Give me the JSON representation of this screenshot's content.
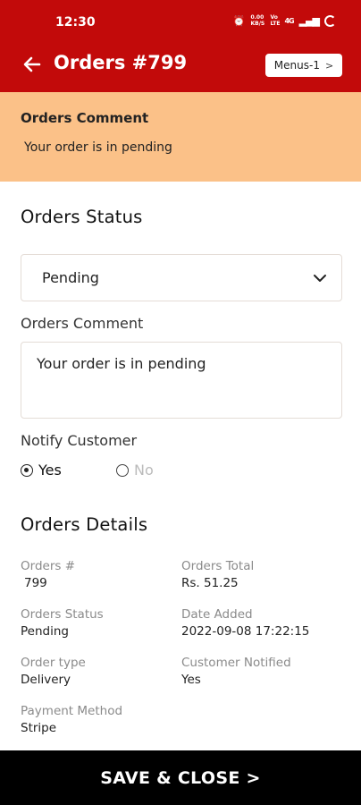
{
  "status_bar": {
    "time": "12:30",
    "data_speed": "0.00 KB/S",
    "network": "Vo LTE",
    "signal": "4G"
  },
  "header": {
    "title": "Orders #799",
    "menus_label": "Menus-1",
    "menus_chevron": ">",
    "background": "#c20a0a"
  },
  "comment_banner": {
    "heading": "Orders Comment",
    "text": "Your order is in pending",
    "background": "#fbc188"
  },
  "status_section": {
    "title": "Orders Status",
    "selected_status": "Pending",
    "comment_label": "Orders Comment",
    "comment_value": "Your order is in pending",
    "notify_label": "Notify Customer",
    "notify_options": [
      {
        "label": "Yes",
        "selected": true
      },
      {
        "label": "No",
        "selected": false
      }
    ]
  },
  "details": {
    "title": "Orders Details",
    "fields": [
      {
        "label": "Orders #",
        "value": "799"
      },
      {
        "label": "Orders Total",
        "value": "Rs.  51.25"
      },
      {
        "label": "Orders Status",
        "value": "Pending"
      },
      {
        "label": "Date Added",
        "value": "2022-09-08  17:22:15"
      },
      {
        "label": "Order type",
        "value": "Delivery"
      },
      {
        "label": "Customer Notified",
        "value": "Yes"
      },
      {
        "label": "Payment Method",
        "value": "Stripe"
      }
    ]
  },
  "footer": {
    "save_close_label": "SAVE & CLOSE >"
  }
}
